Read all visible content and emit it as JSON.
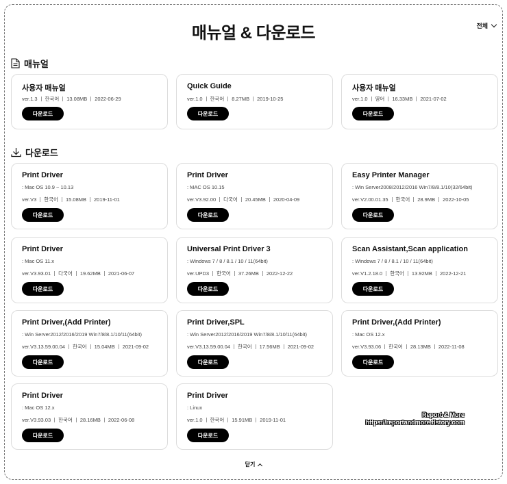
{
  "title": "매뉴얼 & 다운로드",
  "filter_label": "전체",
  "close_label": "닫기",
  "download_label": "다운로드",
  "watermark": {
    "line1": "Report & More",
    "line2": "https://reportandmore.tistory.com"
  },
  "sections": {
    "manual": {
      "label": "매뉴얼",
      "icon": "document-icon"
    },
    "download": {
      "label": "다운로드",
      "icon": "download-icon"
    }
  },
  "manuals": [
    {
      "title": "사용자 매뉴얼",
      "ver": "ver.1.3",
      "lang": "한국어",
      "size": "13.08MB",
      "date": "2022-06-29"
    },
    {
      "title": "Quick Guide",
      "ver": "ver.1.0",
      "lang": "한국어",
      "size": "8.27MB",
      "date": "2019-10-25"
    },
    {
      "title": "사용자 매뉴얼",
      "ver": "ver.1.0",
      "lang": "영어",
      "size": "16.33MB",
      "date": "2021-07-02"
    }
  ],
  "downloads": [
    {
      "title": "Print Driver",
      "os": ": Mac OS 10.9 ~ 10.13",
      "ver": "ver.V3",
      "lang": "한국어",
      "size": "15.08MB",
      "date": "2019-11-01"
    },
    {
      "title": "Print Driver",
      "os": ": MAC OS 10.15",
      "ver": "ver.V3.92.00",
      "lang": "다국어",
      "size": "20.45MB",
      "date": "2020-04-09"
    },
    {
      "title": "Easy Printer Manager",
      "os": ": Win Server2008/2012/2016 Win7/8/8.1/10(32/64bit)",
      "ver": "ver.V2.00.01.35",
      "lang": "한국어",
      "size": "28.9MB",
      "date": "2022-10-05"
    },
    {
      "title": "Print Driver",
      "os": ": Mac OS 11.x",
      "ver": "ver.V3.93.01",
      "lang": "다국어",
      "size": "19.62MB",
      "date": "2021-06-07"
    },
    {
      "title": "Universal Print Driver 3",
      "os": ": Windows 7 / 8 / 8.1 / 10 / 11(64bit)",
      "ver": "ver.UPD3",
      "lang": "한국어",
      "size": "37.26MB",
      "date": "2022-12-22"
    },
    {
      "title": "Scan Assistant,Scan application",
      "os": ": Windows 7 / 8 / 8.1 / 10 / 11(64bit)",
      "ver": "ver.V1.2.18.0",
      "lang": "한국어",
      "size": "13.92MB",
      "date": "2022-12-21"
    },
    {
      "title": "Print Driver,(Add Printer)",
      "os": ": Win Server2012/2016/2019 Win7/8/8.1/10/11(64bit)",
      "ver": "ver.V3.13.59.00.04",
      "lang": "한국어",
      "size": "15.04MB",
      "date": "2021-09-02"
    },
    {
      "title": "Print Driver,SPL",
      "os": ": Win Server2012/2016/2019 Win7/8/8.1/10/11(64bit)",
      "ver": "ver.V3.13.59.00.04",
      "lang": "한국어",
      "size": "17.56MB",
      "date": "2021-09-02"
    },
    {
      "title": "Print Driver,(Add Printer)",
      "os": ": Mac OS 12.x",
      "ver": "ver.V3.93.06",
      "lang": "한국어",
      "size": "28.13MB",
      "date": "2022-11-08"
    },
    {
      "title": "Print Driver",
      "os": ": Mac OS 12.x",
      "ver": "ver.V3.93.03",
      "lang": "한국어",
      "size": "28.16MB",
      "date": "2022-06-08"
    },
    {
      "title": "Print Driver",
      "os": ": Linux",
      "ver": "ver.1.0",
      "lang": "한국어",
      "size": "15.91MB",
      "date": "2019-11-01"
    }
  ]
}
